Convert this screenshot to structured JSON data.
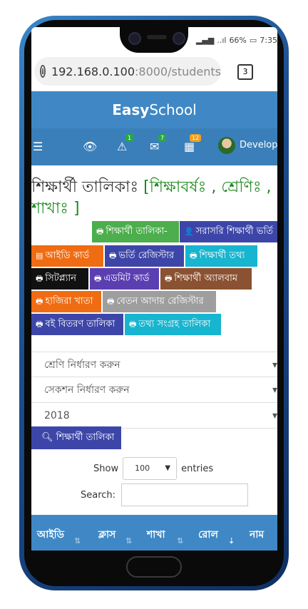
{
  "status": {
    "signal": "..ıl",
    "battery": "66%",
    "time": "7:35"
  },
  "browser": {
    "url_host": "192.168.0.100",
    "url_rest": ":8000/students",
    "tab_count": "3"
  },
  "app": {
    "brand_bold": "Easy",
    "brand_rest": "School"
  },
  "nav": {
    "alerts_count": "1",
    "messages_count": "7",
    "apps_count": "12",
    "user": "Develope"
  },
  "page": {
    "title_prefix": "শিক্ষার্থী তালিকাঃ ",
    "title_green": "[শিক্ষাবর্ষঃ , শ্রেণিঃ , শাখাঃ ]"
  },
  "buttons": [
    {
      "label": "শিক্ষার্থী তালিকা-",
      "color": "#4cae4c"
    },
    {
      "label": "সরাসরি শিক্ষার্থী ভর্তি",
      "color": "#3d46a8"
    },
    {
      "label": "আইডি কার্ড",
      "color": "#f06c12"
    },
    {
      "label": "ভর্তি রেজিস্টার",
      "color": "#3d46a8"
    },
    {
      "label": "শিক্ষার্থী তথ্য",
      "color": "#17b5cf"
    },
    {
      "label": "সিটপ্ল্যান",
      "color": "#111111"
    },
    {
      "label": "এডমিট কার্ড",
      "color": "#5b3fb2"
    },
    {
      "label": "শিক্ষার্থী অ্যালবাম",
      "color": "#8a5232"
    },
    {
      "label": "হাজিরা খাতা",
      "color": "#f06c12"
    },
    {
      "label": "বেতন আদায় রেজিস্টার",
      "color": "#9e9e9e"
    },
    {
      "label": "বই বিতরণ তালিকা",
      "color": "#3d46a8"
    },
    {
      "label": "তথ্য সংগ্রহ তালিকা",
      "color": "#17b5cf"
    }
  ],
  "filters": {
    "class_placeholder": "শ্রেণি নির্ধারণ করুন",
    "section_placeholder": "সেকশন নির্ধারণ করুন",
    "year_value": "2018",
    "search_button": "শিক্ষার্থী তালিকা"
  },
  "datatable": {
    "show_label": "Show",
    "length_value": "100",
    "entries_label": "entries",
    "search_label": "Search:",
    "columns": [
      "আইডি",
      "ক্লাস",
      "শাখা",
      "রোল",
      "নাম"
    ]
  }
}
